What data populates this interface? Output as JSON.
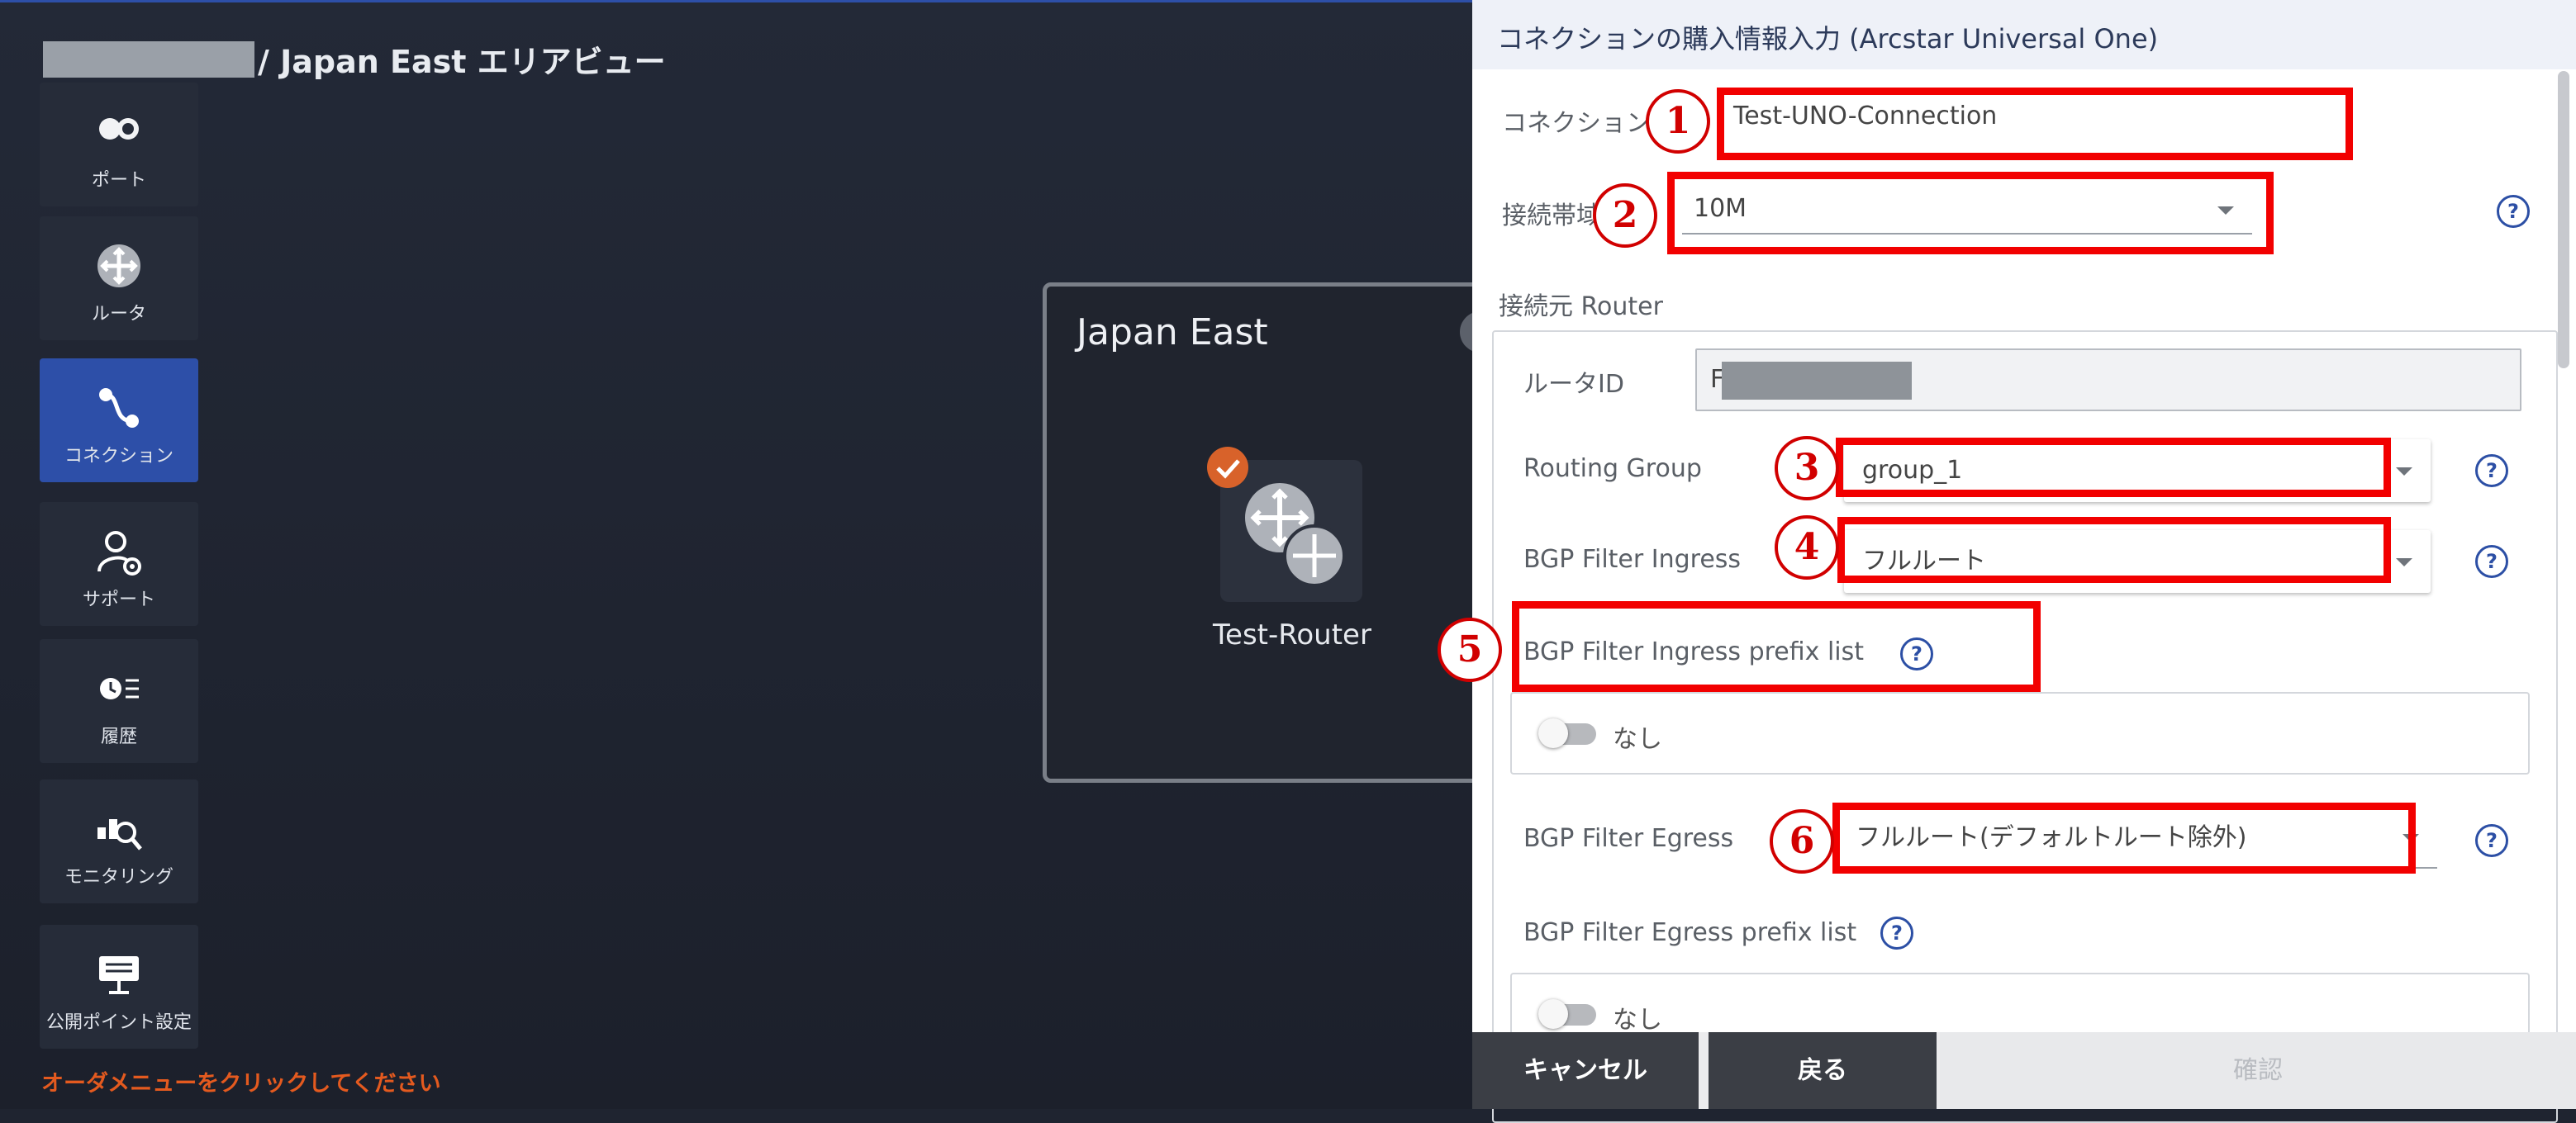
{
  "breadcrumb": {
    "title": "/ Japan East エリアビュー"
  },
  "sidebar": {
    "items": [
      {
        "label": "ポート",
        "icon": "port-icon",
        "active": false
      },
      {
        "label": "ルータ",
        "icon": "router-icon",
        "active": false
      },
      {
        "label": "コネクション",
        "icon": "connection-icon",
        "active": true
      },
      {
        "label": "サポート",
        "icon": "support-icon",
        "active": false
      },
      {
        "label": "履歴",
        "icon": "history-icon",
        "active": false
      },
      {
        "label": "モニタリング",
        "icon": "monitoring-icon",
        "active": false
      },
      {
        "label": "公開ポイント設定",
        "icon": "public-point-icon",
        "active": false
      }
    ],
    "hint": "オーダメニューをクリックしてください"
  },
  "area_card": {
    "name": "Japan East",
    "router_name": "Test-Router"
  },
  "panel": {
    "title": "コネクションの購入情報入力 (Arcstar Universal One)",
    "connection_name": {
      "label": "コネクション名",
      "value": "Test-UNO-Connection"
    },
    "bandwidth": {
      "label": "接続帯域",
      "value": "10M"
    },
    "source_router": {
      "section_label": "接続元 Router",
      "router_id": {
        "label": "ルータID",
        "value": "F"
      },
      "routing_group": {
        "label": "Routing Group",
        "value": "group_1"
      },
      "bgp_ingress": {
        "label": "BGP Filter Ingress",
        "value": "フルルート"
      },
      "bgp_ingress_prefix": {
        "label": "BGP Filter Ingress prefix list",
        "toggle_label": "なし"
      },
      "bgp_egress": {
        "label": "BGP Filter Egress",
        "value": "フルルート(デフォルトルート除外)"
      },
      "bgp_egress_prefix": {
        "label": "BGP Filter Egress prefix list",
        "toggle_label": "なし"
      }
    },
    "help_glyph": "?"
  },
  "footer": {
    "cancel": "キャンセル",
    "back": "戻る",
    "confirm": "確認"
  },
  "callouts": [
    "1",
    "2",
    "3",
    "4",
    "5",
    "6"
  ],
  "colors": {
    "accent": "#2d4fa8",
    "highlight": "#f20000",
    "warning": "#e45a1f",
    "router_check": "#d8622a"
  }
}
